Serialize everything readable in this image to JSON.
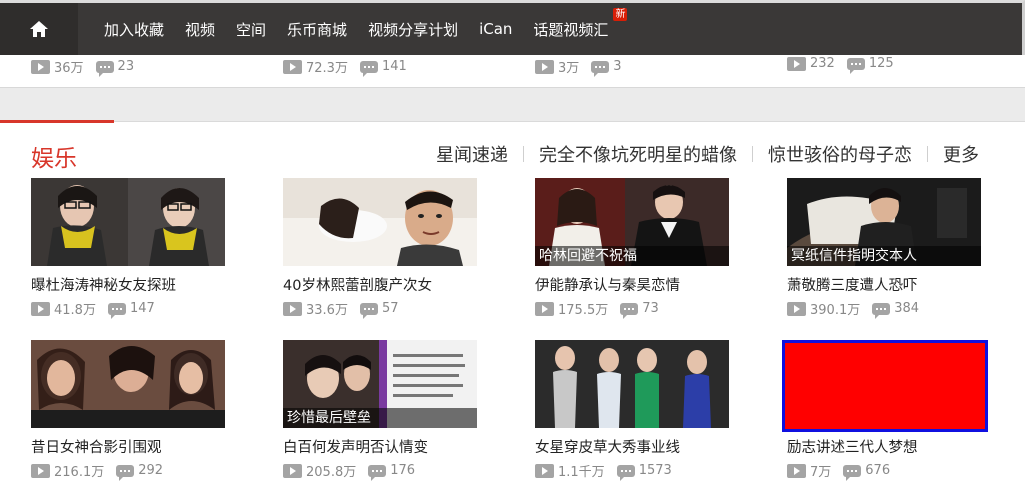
{
  "topbar": {
    "home_icon": "home-icon",
    "nav": [
      {
        "label": "加入收藏"
      },
      {
        "label": "视频"
      },
      {
        "label": "空间"
      },
      {
        "label": "乐币商城"
      },
      {
        "label": "视频分享计划"
      },
      {
        "label": "iCan"
      },
      {
        "label": "话题视频汇",
        "badge": "新"
      }
    ],
    "colors": {
      "bar": "#3a3837",
      "badge": "#d81e06"
    }
  },
  "prev_row": [
    {
      "plays": "36万",
      "comments": "23"
    },
    {
      "plays": "72.3万",
      "comments": "141"
    },
    {
      "plays": "3万",
      "comments": "3"
    },
    {
      "plays": "232",
      "comments": "125"
    }
  ],
  "section": {
    "title": "娱乐",
    "accent_color": "#d8362a",
    "links": [
      "星闻速递",
      "完全不像坑死明星的蜡像",
      "惊世骇俗的母子恋",
      "更多"
    ],
    "cards": [
      {
        "title": "曝杜海涛神秘女友探班",
        "plays": "41.8万",
        "comments": "147",
        "caption": "",
        "thumb": "photo-two-women-yellow-scarves"
      },
      {
        "title": "40岁林熙蕾剖腹产次女",
        "plays": "33.6万",
        "comments": "57",
        "caption": "",
        "thumb": "photo-couple-selfie"
      },
      {
        "title": "伊能静承认与秦昊恋情",
        "plays": "175.5万",
        "comments": "73",
        "caption": "哈林回避不祝福",
        "thumb": "photo-couple-event"
      },
      {
        "title": "萧敬腾三度遭人恐吓",
        "plays": "390.1万",
        "comments": "384",
        "caption": "冥纸信件指明交本人",
        "thumb": "photo-man-on-sofa"
      },
      {
        "title": "昔日女神合影引围观",
        "plays": "216.1万",
        "comments": "292",
        "caption": "",
        "thumb": "photo-three-women"
      },
      {
        "title": "白百何发声明否认情变",
        "plays": "205.8万",
        "comments": "176",
        "caption": "珍惜最后壁垒",
        "thumb": "photo-couple-document"
      },
      {
        "title": "女星穿皮草大秀事业线",
        "plays": "1.1千万",
        "comments": "1573",
        "caption": "",
        "thumb": "photo-red-carpet-women"
      },
      {
        "title": "励志讲述三代人梦想",
        "plays": "7万",
        "comments": "676",
        "caption": "",
        "thumb": "red-placeholder"
      }
    ]
  }
}
